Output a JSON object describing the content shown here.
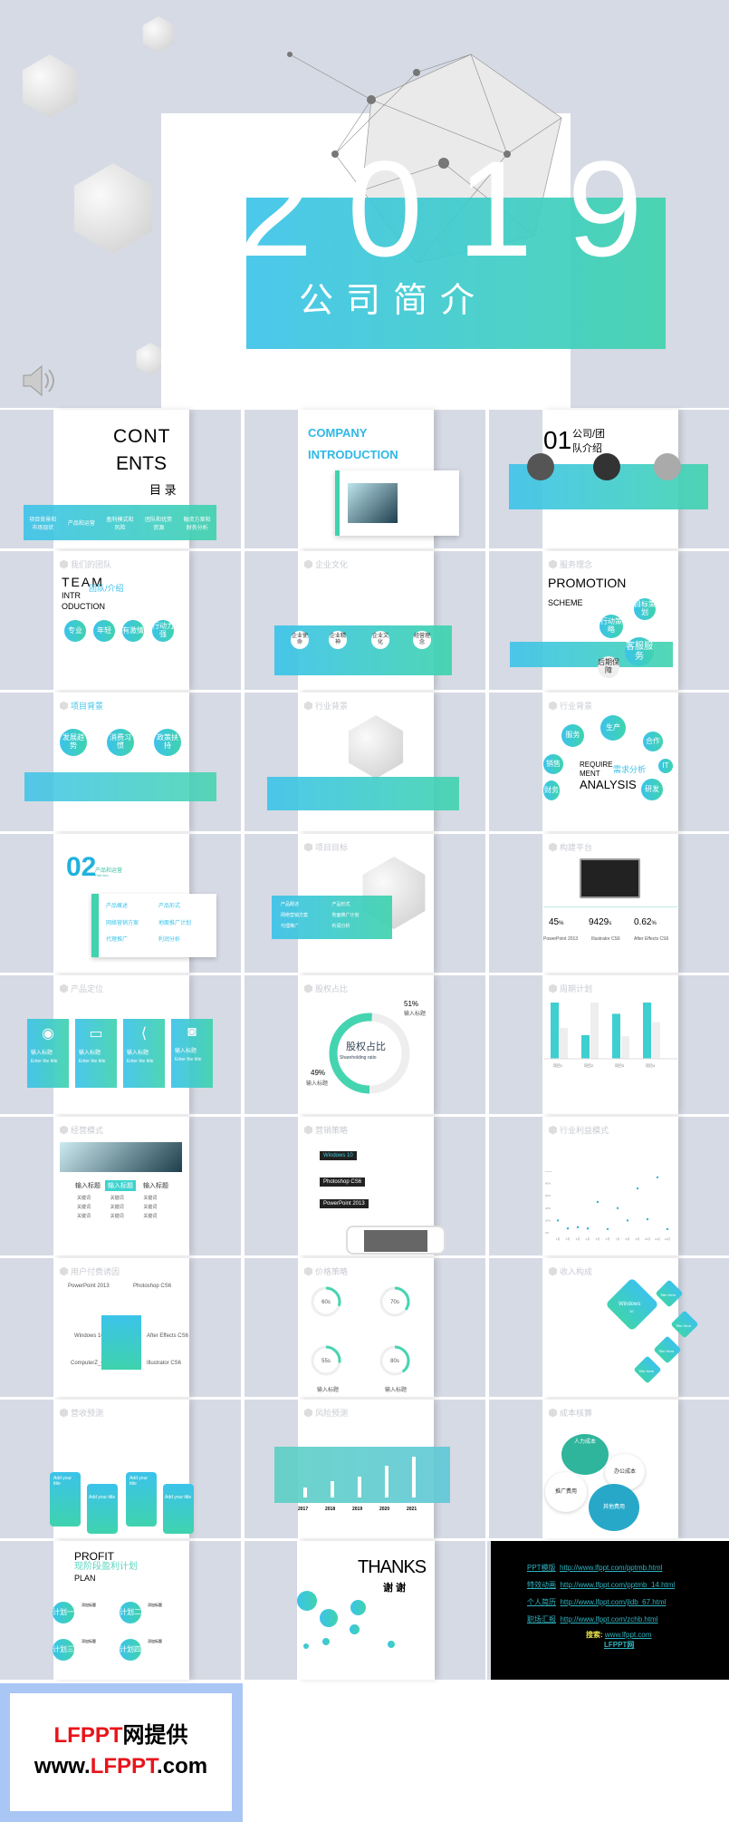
{
  "cover": {
    "year": "2019",
    "subtitle": "公司简介",
    "speaker_icon": "speaker-icon"
  },
  "colors": {
    "accent_blue": "#3cc3ea",
    "accent_teal": "#3fd3ae",
    "background": "#d6dae4",
    "logo_red": "#e8141b"
  },
  "slides": {
    "contents": {
      "title1": "CONT",
      "title2": "ENTS",
      "cn": "目 录",
      "items": [
        "项目背景和市场现状",
        "产品和运营",
        "盈利模式和风险",
        "团队和优势资源",
        "融资方案和财务分析"
      ]
    },
    "company": {
      "title1": "COMPANY",
      "title2": "INTRODUCTION"
    },
    "team01": {
      "num": "01",
      "title": "公司/团队介绍",
      "badges": [
        "1",
        "2",
        "3"
      ]
    },
    "team": {
      "header": "我们的团队",
      "t1": "TEAM",
      "t2": "INTR",
      "t3": "ODUCTION",
      "cn": "团队/介绍",
      "circles": [
        "专业",
        "年轻",
        "有激情",
        "行动力强"
      ]
    },
    "culture": {
      "header": "企业文化",
      "circles": [
        "企业使命",
        "企业精神",
        "企业文化",
        "经营理念"
      ]
    },
    "promotion": {
      "header": "服务理念",
      "t1": "PROMOTION",
      "t2": "SCHEME",
      "circles": [
        "目标策划",
        "行动策略",
        "客服服务",
        "后期保障"
      ]
    },
    "project_bg": {
      "header": "项目背景",
      "circles": [
        "发展趋势",
        "消费习惯",
        "政策扶持"
      ],
      "nums": [
        "1",
        "2",
        "3"
      ]
    },
    "industry_bg": {
      "header": "行业背景"
    },
    "requirement": {
      "header": "行业背景",
      "t1": "REQUIRE",
      "t2": "MENT",
      "t3": "ANALYSIS",
      "cn": "需求分析",
      "circles": [
        "服务",
        "生产",
        "合作",
        "销售",
        "IT",
        "财务",
        "研发"
      ]
    },
    "product": {
      "num": "02",
      "title": "产品和运营",
      "sub": "Part two",
      "items": [
        "产品概述",
        "产品形式",
        "网络营销方案",
        "地面推广计划",
        "代理推广",
        "利润分析"
      ]
    },
    "goal": {
      "header": "项目目标",
      "items": [
        "产品概述",
        "产品形式",
        "网络营销方案",
        "地面推广计划",
        "代理推广",
        "利润分析"
      ]
    },
    "platform": {
      "header": "构建平台",
      "stats": [
        {
          "value": "45",
          "unit": "%",
          "label": "PowerPoint 2013"
        },
        {
          "value": "9429",
          "unit": "s",
          "label": "Illustrator CS6"
        },
        {
          "value": "0.62",
          "unit": "%",
          "label": "After Effects CS6"
        }
      ]
    },
    "positioning": {
      "header": "产品定位",
      "cards": [
        {
          "icon": "wifi-icon",
          "title": "输入标题",
          "sub": "Enter the title"
        },
        {
          "icon": "monitor-icon",
          "title": "输入标题",
          "sub": "Enter the title"
        },
        {
          "icon": "share-icon",
          "title": "输入标题",
          "sub": "Enter the title"
        },
        {
          "icon": "camera-icon",
          "title": "输入标题",
          "sub": "Enter the title"
        }
      ]
    },
    "equity": {
      "header": "股权占比",
      "cn": "股权占比",
      "en": "Shareholding ratio",
      "p1": "51%",
      "p2": "49%",
      "label1": "输入标题",
      "label2": "输入标题",
      "share": 51
    },
    "cycle": {
      "header": "周期计划",
      "cats": [
        "项目1",
        "项目2",
        "项目3",
        "项目4"
      ],
      "values": [
        100,
        42,
        80,
        100
      ],
      "values2": [
        55,
        100,
        40,
        65
      ]
    },
    "business": {
      "header": "经营模式",
      "tabs": [
        "输入标题",
        "输入标题",
        "输入标题"
      ],
      "keyword": "关键词"
    },
    "marketing": {
      "header": "营销策略",
      "items": [
        "Windows 10",
        "Photoshop CS6",
        "PowerPoint 2013"
      ]
    },
    "profit_mode": {
      "header": "行业利益模式",
      "y_ticks": [
        "0%",
        "20%",
        "40%",
        "60%",
        "80%",
        "100%"
      ],
      "x_ticks": [
        "1月",
        "2月",
        "3月",
        "4月",
        "5月",
        "6月",
        "7月",
        "8月",
        "9月",
        "10月",
        "11月",
        "12月"
      ],
      "values": [
        20,
        7,
        9,
        7,
        50,
        6,
        40,
        20,
        72,
        22,
        90,
        6
      ]
    },
    "payment": {
      "header": "用户付费诱因",
      "items": [
        "PowerPoint 2013",
        "Photoshop CS6",
        "Windows 10",
        "After Effects CS6",
        "ComputerZ_CN",
        "Illustrator CS6"
      ]
    },
    "price": {
      "header": "价格策略",
      "rings": [
        {
          "value": "60s",
          "pct": 60
        },
        {
          "value": "70s",
          "pct": 70
        },
        {
          "value": "55s",
          "pct": 55
        },
        {
          "value": "80s",
          "pct": 80
        }
      ],
      "label": "输入标题"
    },
    "income": {
      "header": "收入构成",
      "main": "Windows",
      "sub": "10",
      "tiles": [
        "Title Here",
        "Title Here",
        "Title Here",
        "Title Here"
      ]
    },
    "revenue": {
      "header": "营收预测",
      "cards": [
        "Add your title",
        "Add your title",
        "Add your title",
        "Add your title"
      ]
    },
    "risk": {
      "header": "风险预测",
      "years": [
        "2017",
        "2018",
        "2019",
        "2020",
        "2021"
      ],
      "values": [
        25,
        40,
        52,
        78,
        100
      ]
    },
    "cost": {
      "header": "成本核算",
      "items": [
        "人力成本",
        "办公成本",
        "推广费用",
        "其他费用"
      ]
    },
    "plan": {
      "t1": "PROFIT",
      "cn": "现阶段盈利计划",
      "t2": "PLAN",
      "circles": [
        "计划一",
        "计划二",
        "计划三",
        "计划四"
      ],
      "heading": "添加标题"
    },
    "thanks": {
      "en": "THANKS",
      "cn": "谢 谢"
    },
    "links": [
      {
        "label": "PPT模版",
        "url": "http://www.lfppt.com/pptmb.html"
      },
      {
        "label": "特效动画",
        "url": "http://www.lfppt.com/pptmb_14.html"
      },
      {
        "label": "个人简历",
        "url": "http://www.lfppt.com/jldb_67.html"
      },
      {
        "label": "职场汇报",
        "url": "http://www.lfppt.com/zchb.html"
      }
    ],
    "search": {
      "label": "搜索:",
      "url": "www.lfppt.com",
      "name": "LFPPT网"
    }
  },
  "logo": {
    "line1_red": "LFPPT",
    "line1_black": "网提供",
    "line2_a": "www.",
    "line2_red": "LFPPT",
    "line2_b": ".com"
  }
}
